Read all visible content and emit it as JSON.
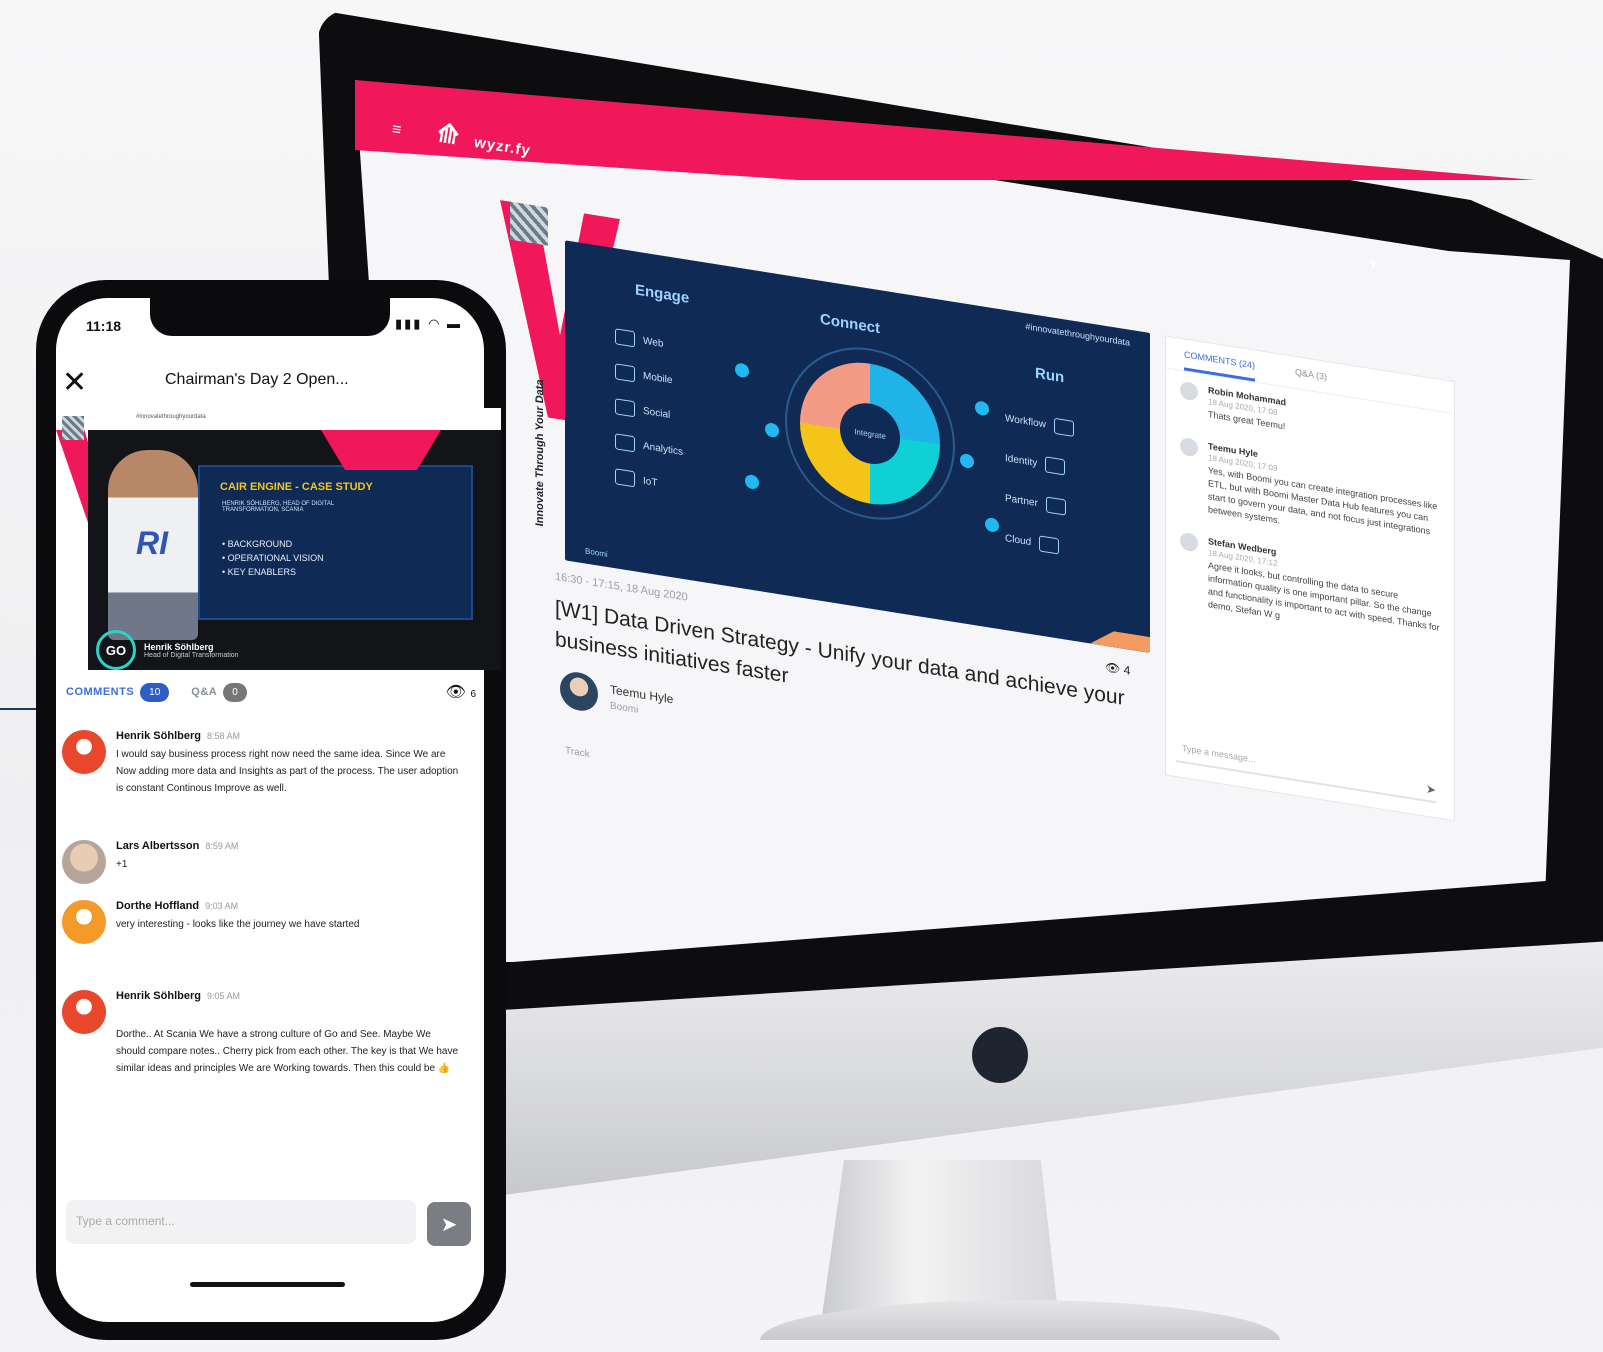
{
  "desktop": {
    "brand": {
      "menu_icon": "menu-icon",
      "logo_icon": "logo-icon",
      "text": "wyzr.fy"
    },
    "topbar_right": "▾",
    "event_title_vertical": "Innovate Through Your Data",
    "slide": {
      "hashtag": "#innovatethroughyourdata",
      "engage": "Engage",
      "connect": "Connect",
      "run": "Run",
      "center": "Integrate",
      "left_items": [
        "Web",
        "Mobile",
        "Social",
        "Analytics",
        "IoT"
      ],
      "right_items": [
        "Workflow",
        "Identity",
        "Partner",
        "Cloud"
      ],
      "footer": "Boomi"
    },
    "session_meta": "16:30 - 17:15, 18 Aug 2020",
    "session_title": "[W1] Data Driven Strategy - Unify your data and achieve your business initiatives faster",
    "view_count": "4",
    "speaker": {
      "name": "Teemu Hyle",
      "company": "Boomi"
    },
    "track": "Track",
    "comments_panel": {
      "tabs": [
        "COMMENTS (24)",
        "Q&A (3)"
      ],
      "items": [
        {
          "name": "Robin Mohammad",
          "time": "18 Aug 2020, 17:08",
          "text": "Thats great Teemu!"
        },
        {
          "name": "Teemu Hyle",
          "time": "18 Aug 2020, 17:09",
          "text": "Yes, with Boomi you can create integration processes like ETL, but with Boomi Master Data Hub features you can start to govern your data, and not focus just integrations between systems."
        },
        {
          "name": "Stefan Wedberg",
          "time": "18 Aug 2020, 17:12",
          "text": "Agree it looks, but controlling the data to secure information quality is one important pillar. So the change and functionality is important to act with speed. Thanks for demo, Stefan W g"
        }
      ],
      "input_placeholder": "Type a message...",
      "send_icon": "send-icon"
    }
  },
  "phone": {
    "status": {
      "time": "11:18",
      "icons": "▮▮▮ ◠ ▬"
    },
    "title": "Chairman's Day 2 Open...",
    "close_icon": "close-icon",
    "stage": {
      "hashtag": "#innovatethroughyourdata",
      "slide_title": "CAIR ENGINE - CASE STUDY",
      "slide_sub": "HENRIK SÖHLBERG, HEAD OF DIGITAL TRANSFORMATION, SCANIA",
      "bullets": [
        "BACKGROUND",
        "OPERATIONAL VISION",
        "KEY ENABLERS"
      ],
      "shirt_text": "RI",
      "nameplate_logo": "GO",
      "speaker_name": "Henrik Söhlberg",
      "speaker_role": "Head of Digital Transformation"
    },
    "tabs": [
      {
        "label": "COMMENTS",
        "count": "10"
      },
      {
        "label": "Q&A",
        "count": "0"
      }
    ],
    "view_count": "6",
    "comments": [
      {
        "name": "Henrik Söhlberg",
        "time": "8:58 AM",
        "avatar": "red",
        "text": "I would say business process right now need the same idea. Since We are Now adding more data and Insights as part of the process. The user adoption is constant Continous Improve as well."
      },
      {
        "name": "Lars Albertsson",
        "time": "8:59 AM",
        "avatar": "photo",
        "text": "+1"
      },
      {
        "name": "Dorthe Hoffland",
        "time": "9:03 AM",
        "avatar": "orange",
        "text": "very interesting - looks like the journey we have started"
      },
      {
        "name": "Henrik Söhlberg",
        "time": "9:05 AM",
        "avatar": "red",
        "text": "Dorthe.. At Scania We have a strong culture of Go and See. Maybe We should compare notes.. Cherry pick from each other. The key is that We have similar ideas and principles We are Working towards. Then this could be 👍"
      }
    ],
    "input_placeholder": "Type a comment...",
    "send_icon": "send-icon"
  }
}
